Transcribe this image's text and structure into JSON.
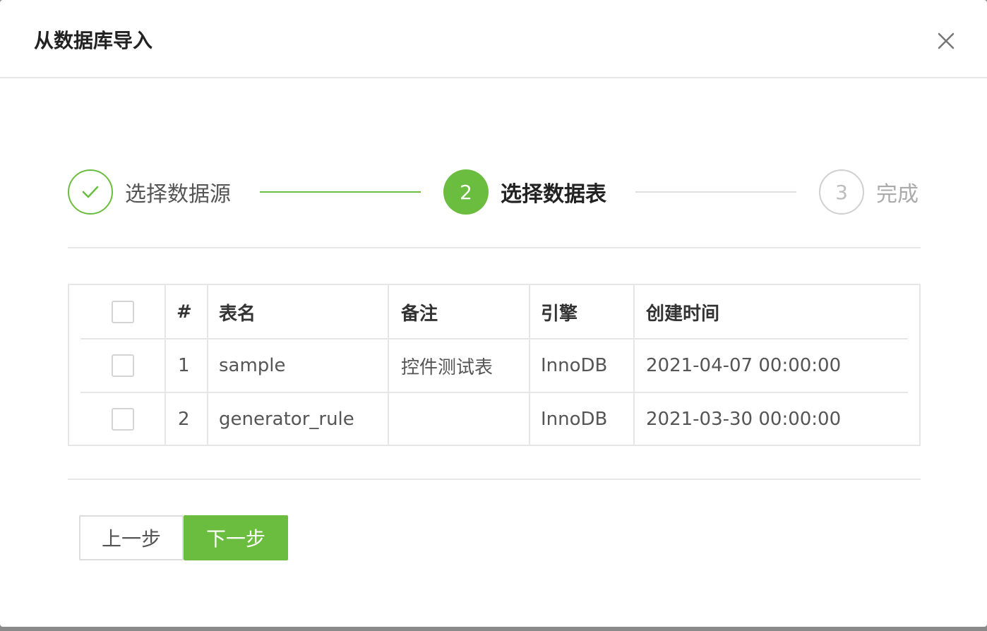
{
  "modal": {
    "title": "从数据库导入"
  },
  "steps": [
    {
      "number": "",
      "label": "选择数据源",
      "status": "done"
    },
    {
      "number": "2",
      "label": "选择数据表",
      "status": "active"
    },
    {
      "number": "3",
      "label": "完成",
      "status": "wait"
    }
  ],
  "table": {
    "columns": [
      "",
      "#",
      "表名",
      "备注",
      "引擎",
      "创建时间"
    ],
    "rows": [
      {
        "index": "1",
        "name": "sample",
        "comment": "控件测试表",
        "engine": "InnoDB",
        "created": "2021-04-07 00:00:00"
      },
      {
        "index": "2",
        "name": "generator_rule",
        "comment": "",
        "engine": "InnoDB",
        "created": "2021-03-30 00:00:00"
      }
    ]
  },
  "buttons": {
    "prev_label": "上一步",
    "next_label": "下一步"
  },
  "colors": {
    "accent": "#6bbd3f",
    "border": "#e6e6e6"
  }
}
